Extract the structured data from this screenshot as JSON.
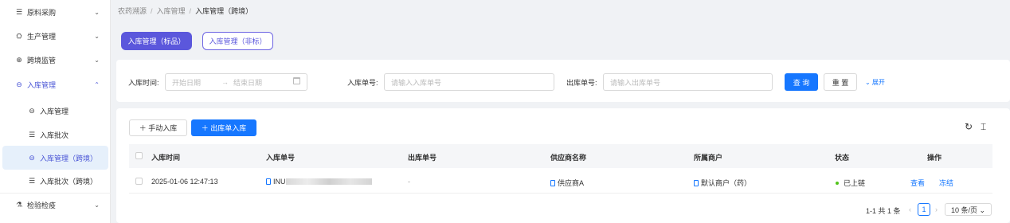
{
  "sidebar": {
    "items": [
      {
        "icon": "☰",
        "label": "原料采购",
        "chevron": "⌄"
      },
      {
        "icon": "⛭",
        "label": "生产管理",
        "chevron": "⌄"
      },
      {
        "icon": "⊕",
        "label": "跨境监管",
        "chevron": "⌄"
      },
      {
        "icon": "⊖",
        "label": "入库管理",
        "chevron": "⌃"
      },
      {
        "icon": "⊖",
        "label": "入库管理"
      },
      {
        "icon": "☰",
        "label": "入库批次"
      },
      {
        "icon": "⊖",
        "label": "入库管理（跨境）"
      },
      {
        "icon": "☰",
        "label": "入库批次（跨境）"
      },
      {
        "icon": "⚗",
        "label": "检验检疫",
        "chevron": "⌄"
      }
    ]
  },
  "breadcrumb": {
    "item1": "农药溯源",
    "sep": "/",
    "item2": "入库管理",
    "item3": "入库管理（跨境）"
  },
  "tabs": {
    "tab1": "入库管理（标品）",
    "tab2": "入库管理（非标）"
  },
  "filters": {
    "time_label": "入库时间:",
    "start_placeholder": "开始日期",
    "arrow": "→",
    "end_placeholder": "结束日期",
    "inbound_label": "入库单号:",
    "inbound_placeholder": "请输入入库单号",
    "outbound_label": "出库单号:",
    "outbound_placeholder": "请输入出库单号",
    "query": "查 询",
    "reset": "重 置",
    "expand": "⌄ 展开"
  },
  "toolbar": {
    "manual": "＋ 手动入库",
    "from_outbound": "＋ 出库单入库",
    "refresh": "↻",
    "density": "⌶"
  },
  "table": {
    "headers": [
      "入库时间",
      "入库单号",
      "出库单号",
      "供应商名称",
      "所属商户",
      "状态",
      "操作"
    ],
    "rows": [
      {
        "time": "2025-01-06 12:47:13",
        "inbound_prefix": "INU",
        "outbound": "-",
        "supplier": "供应商A",
        "merchant": "默认商户（药）",
        "status": "已上链",
        "view": "查看",
        "freeze": "冻结"
      }
    ]
  },
  "pagination": {
    "summary": "1-1 共 1 条",
    "prev": "‹",
    "page": "1",
    "next": "›",
    "size": "10 条/页 ⌄"
  },
  "colors": {
    "accent": "#5b57dc",
    "primary": "#1677ff",
    "success": "#52c41a"
  }
}
